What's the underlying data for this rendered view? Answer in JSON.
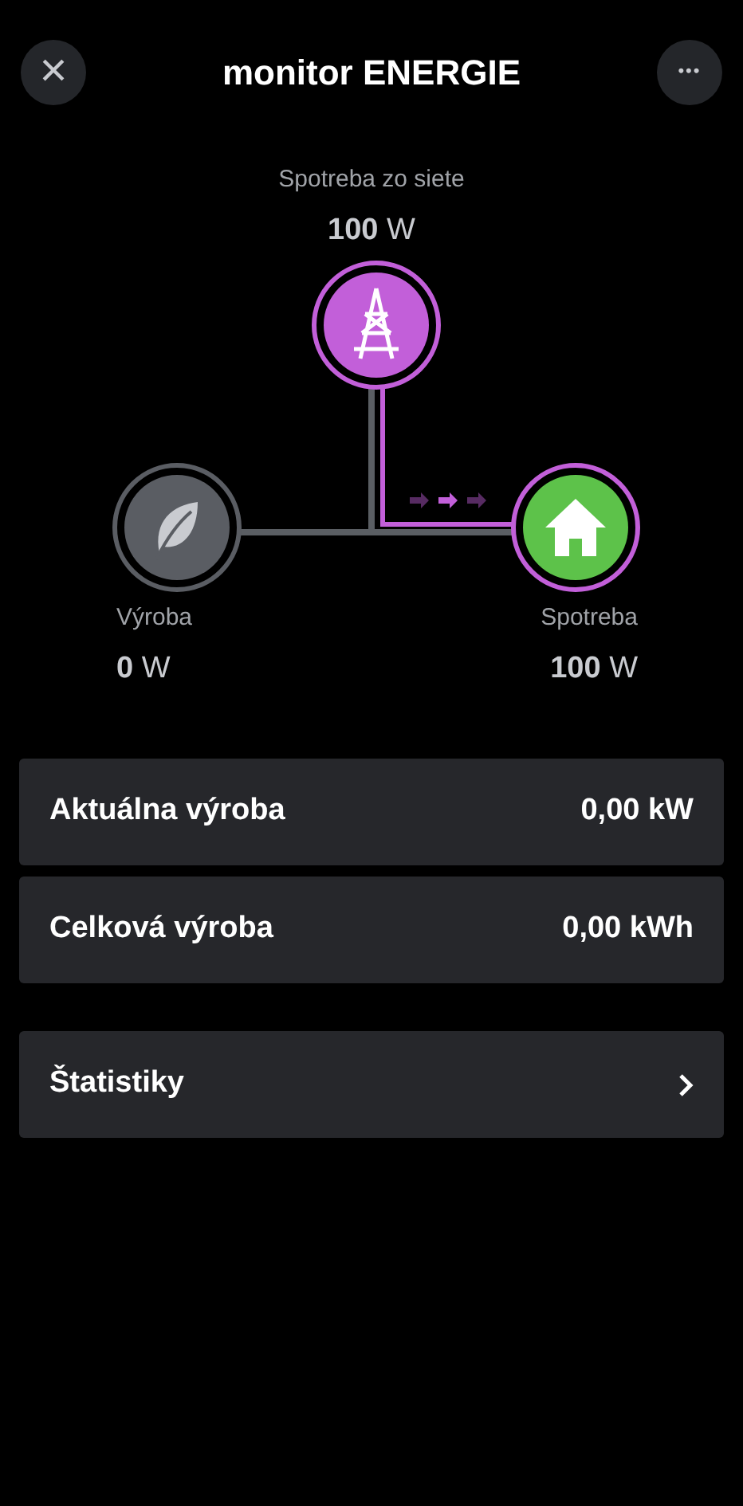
{
  "header": {
    "title": "monitor ENERGIE",
    "close_icon": "×",
    "menu_icon": "•••"
  },
  "grid": {
    "label": "Spotreba zo siete",
    "value": "100",
    "unit": "W",
    "color": "#c25fd9"
  },
  "production": {
    "label": "Výroba",
    "value": "0",
    "unit": "W",
    "color": "#5a5d63"
  },
  "consumption": {
    "label": "Spotreba",
    "value": "100",
    "unit": "W",
    "color": "#5dc24a"
  },
  "stats": [
    {
      "label": "Aktuálna výroba",
      "value": "0,00 kW"
    },
    {
      "label": "Celková výroba",
      "value": "0,00 kWh"
    }
  ],
  "link": {
    "label": "Štatistiky"
  }
}
